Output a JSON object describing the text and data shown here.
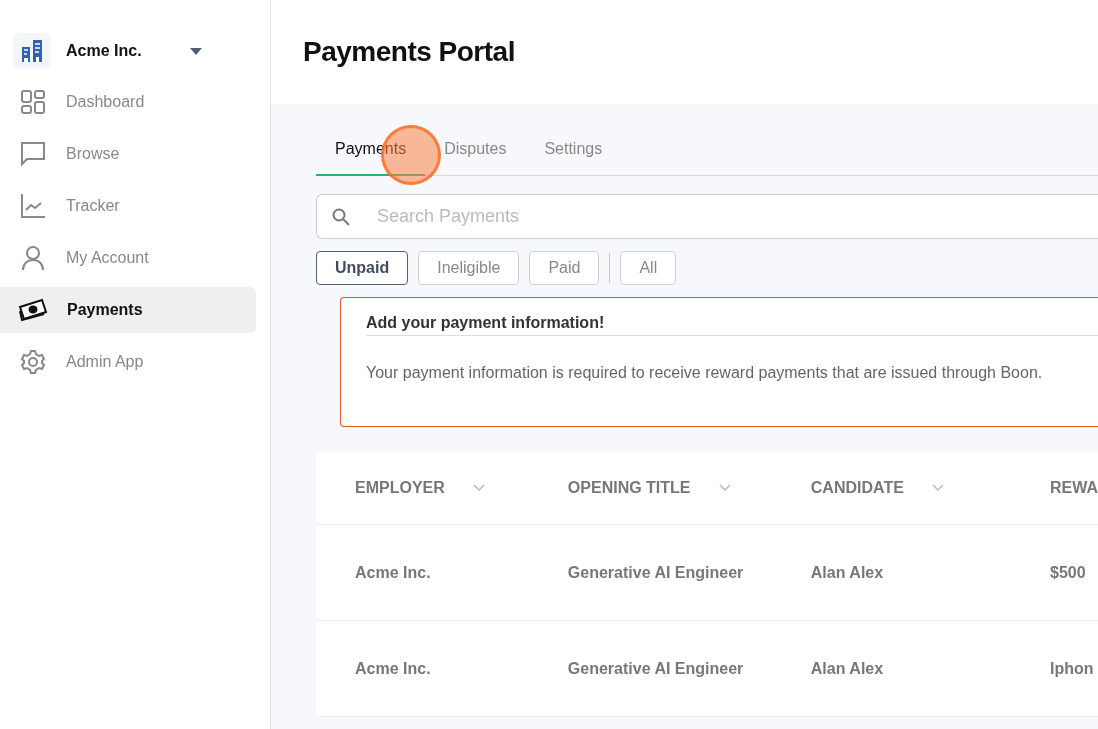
{
  "sidebar": {
    "org": {
      "name": "Acme Inc."
    },
    "items": [
      {
        "label": "Dashboard",
        "selected": false
      },
      {
        "label": "Browse",
        "selected": false
      },
      {
        "label": "Tracker",
        "selected": false
      },
      {
        "label": "My Account",
        "selected": false
      },
      {
        "label": "Payments",
        "selected": true
      },
      {
        "label": "Admin App",
        "selected": false
      }
    ]
  },
  "page": {
    "title": "Payments Portal"
  },
  "tabs": [
    {
      "label": "Payments",
      "selected": true
    },
    {
      "label": "Disputes",
      "selected": false
    },
    {
      "label": "Settings",
      "selected": false
    }
  ],
  "search": {
    "placeholder": "Search Payments"
  },
  "filters": [
    {
      "label": "Unpaid",
      "selected": true
    },
    {
      "label": "Ineligible",
      "selected": false
    },
    {
      "label": "Paid",
      "selected": false
    },
    {
      "label": "All",
      "selected": false
    }
  ],
  "alert": {
    "title": "Add your payment information!",
    "message": "Your payment information is required to receive reward payments that are issued through Boon."
  },
  "table": {
    "columns": [
      {
        "label": "EMPLOYER",
        "sortable": true
      },
      {
        "label": "OPENING TITLE",
        "sortable": true
      },
      {
        "label": "CANDIDATE",
        "sortable": true
      },
      {
        "label": "REWA",
        "sortable": false
      }
    ],
    "rows": [
      [
        "Acme Inc.",
        "Generative AI Engineer",
        "Alan Alex",
        "$500"
      ],
      [
        "Acme Inc.",
        "Generative AI Engineer",
        "Alan Alex",
        "Iphon"
      ]
    ]
  }
}
